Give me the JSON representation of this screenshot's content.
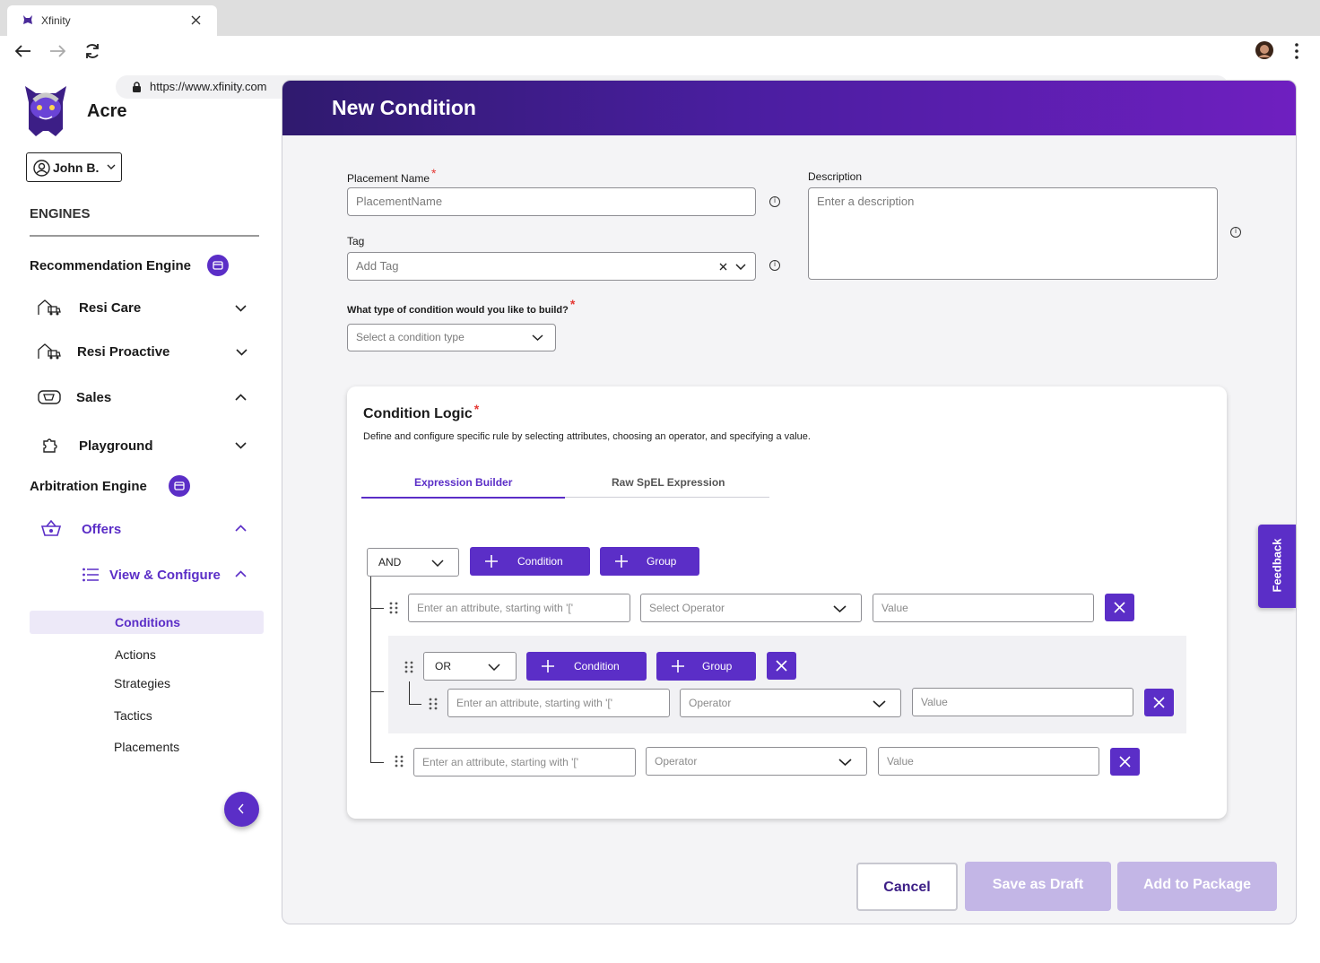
{
  "browser": {
    "tab_title": "Xfinity",
    "url": "https://www.xfinity.com"
  },
  "sidebar": {
    "app_name": "Acre",
    "user": "John B.",
    "section_title": "ENGINES",
    "recommendation_engine": "Recommendation Engine",
    "items": [
      {
        "label": "Resi Care",
        "icon": "truck-home-icon"
      },
      {
        "label": "Resi Proactive",
        "icon": "truck-home-icon"
      },
      {
        "label": "Sales",
        "icon": "cart-icon"
      },
      {
        "label": "Playground",
        "icon": "puzzle-icon"
      }
    ],
    "arbitration_engine": "Arbitration Engine",
    "offers": "Offers",
    "view_configure": "View & Configure",
    "sub_items": [
      "Conditions",
      "Actions",
      "Strategies",
      "Tactics",
      "Placements"
    ],
    "active_sub_item": "Conditions",
    "accent_color": "#5b2ec7"
  },
  "form": {
    "title": "New Condition",
    "placement_name_label": "Placement Name",
    "placement_name_placeholder": "PlacementName",
    "description_label": "Description",
    "description_placeholder": "Enter a description",
    "tag_label": "Tag",
    "tag_placeholder": "Add Tag",
    "condition_type_label": "What type of condition would you like to build?",
    "condition_type_placeholder": "Select a condition type"
  },
  "logic": {
    "title": "Condition Logic",
    "description": "Define and configure specific rule by selecting attributes, choosing an operator, and specifying a value.",
    "tabs": [
      "Expression Builder",
      "Raw SpEL Expression"
    ],
    "active_tab": "Expression Builder",
    "root_operator": "AND",
    "add_condition": "Condition",
    "add_group": "Group",
    "rows": [
      {
        "attribute": "Enter an attribute, starting with '['",
        "operator": "Select Operator",
        "value": "Value"
      },
      {
        "attribute": "Enter an attribute, starting with '['",
        "operator": "Operator",
        "value": "Value"
      }
    ],
    "group": {
      "operator": "OR",
      "rows": [
        {
          "attribute": "Enter an attribute, starting with '['",
          "operator": "Operator",
          "value": "Value"
        }
      ]
    }
  },
  "footer": {
    "cancel": "Cancel",
    "save_draft": "Save as Draft",
    "add_package": "Add to Package"
  },
  "feedback": "Feedback"
}
